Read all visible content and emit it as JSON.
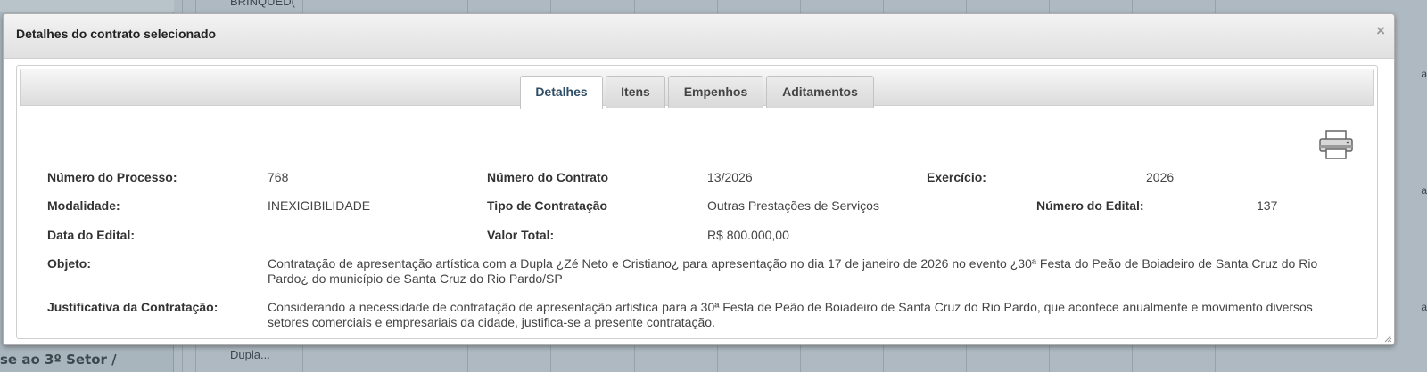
{
  "background": {
    "sidebar_text": "se ao 3º Setor /",
    "top_cell_text": "BRINQUED(",
    "bottom_cell_text": "Dupla...",
    "edge_letters": [
      "a",
      "a",
      "a"
    ]
  },
  "modal": {
    "title": "Detalhes do contrato selecionado",
    "close_glyph": "×",
    "tabs": [
      {
        "label": "Detalhes",
        "active": true
      },
      {
        "label": "Itens",
        "active": false
      },
      {
        "label": "Empenhos",
        "active": false
      },
      {
        "label": "Aditamentos",
        "active": false
      }
    ],
    "details": {
      "numero_processo_label": "Número do Processo:",
      "numero_processo_value": "768",
      "numero_contrato_label": "Número do Contrato",
      "numero_contrato_value": "13/2026",
      "exercicio_label": "Exercício:",
      "exercicio_value": "2026",
      "modalidade_label": "Modalidade:",
      "modalidade_value": "INEXIGIBILIDADE",
      "tipo_contratacao_label": "Tipo de Contratação",
      "tipo_contratacao_value": "Outras Prestações de Serviços",
      "numero_edital_label": "Número do Edital:",
      "numero_edital_value": "137",
      "data_edital_label": "Data do Edital:",
      "data_edital_value": "",
      "valor_total_label": "Valor Total:",
      "valor_total_value": "R$ 800.000,00",
      "objeto_label": "Objeto:",
      "objeto_value": "Contratação de apresentação artística com a Dupla ¿Zé Neto e Cristiano¿ para apresentação no dia 17 de janeiro de 2026 no evento ¿30ª Festa do Peão de Boiadeiro de Santa Cruz do Rio Pardo¿ do município de Santa Cruz do Rio Pardo/SP",
      "justificativa_label": "Justificativa da Contratação:",
      "justificativa_value": "Considerando a necessidade de contratação de apresentação artistica para a 30ª Festa de Peão de Boiadeiro de Santa Cruz do Rio Pardo, que acontece anualmente e movimento diversos setores comerciais e empresariais da cidade, justifica-se a presente contratação."
    },
    "icons": {
      "print": "printer-icon",
      "close": "close-icon"
    }
  }
}
